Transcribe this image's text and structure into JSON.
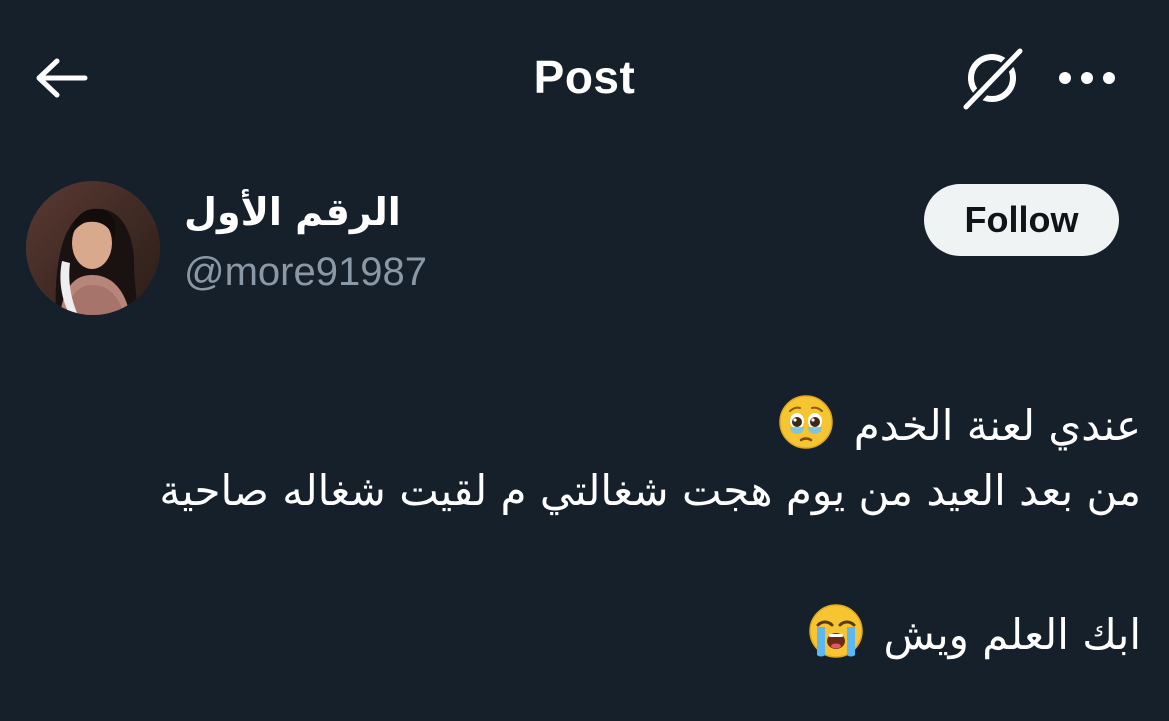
{
  "header": {
    "title": "Post",
    "back_icon": "arrow-left-icon",
    "grok_icon": "grok-icon",
    "more_icon": "more-horizontal-icon"
  },
  "author": {
    "display_name": "الرقم الأول",
    "handle": "@more91987",
    "follow_label": "Follow"
  },
  "post": {
    "line1": "عندي لعنة الخدم",
    "line1_emoji": "face-holding-back-tears-icon",
    "line2": "من بعد العيد من يوم هجت شغالتي م لقيت شغاله صاحية",
    "line3": "ابك العلم ويش",
    "line3_emoji": "loudly-crying-face-icon"
  },
  "colors": {
    "background": "#15202b",
    "secondary_text": "#8b98a5",
    "follow_bg": "#eff3f4",
    "follow_text": "#0f1419"
  }
}
